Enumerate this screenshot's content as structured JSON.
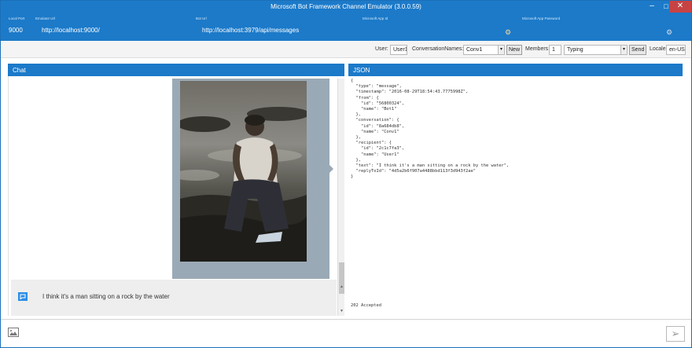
{
  "window": {
    "title": "Microsoft Bot Framework Channel Emulator (3.0.0.59)",
    "minimize": "–",
    "maximize": "□",
    "close": "✕"
  },
  "settings": {
    "local_port": {
      "label": "Local Port",
      "value": "9000"
    },
    "emulator_url": {
      "label": "Emulator Url",
      "value": "http://localhost:9000/"
    },
    "bot_url": {
      "label": "Bot Url",
      "value": "http://localhost:3979/api/messages"
    },
    "app_id": {
      "label": "Microsoft App Id",
      "value": ""
    },
    "app_password": {
      "label": "Microsoft App Password",
      "value": ""
    },
    "gear_icon": "⚙"
  },
  "toolbar": {
    "user_label": "User:",
    "user_value": "User1",
    "conversation_label": "ConversationNames:",
    "conversation_value": "Conv1",
    "new_button": "New",
    "members_label": "Members",
    "members_value": "1",
    "activity_value": "Typing",
    "send_button": "Send",
    "locale_label": "Locale:",
    "locale_value": "en-US",
    "dropdown_icon": "▾"
  },
  "chat": {
    "header": "Chat",
    "message_text": "I think it's a man sitting on a rock by the water",
    "message_icon": "bot-icon"
  },
  "json_panel": {
    "header": "JSON",
    "content": "{\n  \"type\": \"message\",\n  \"timestamp\": \"2016-08-29T18:54:43.7775998Z\",\n  \"from\": {\n    \"id\": \"56800324\",\n    \"name\": \"Bot1\"\n  },\n  \"conversation\": {\n    \"id\": \"8a684db8\",\n    \"name\": \"Conv1\"\n  },\n  \"recipient\": {\n    \"id\": \"2c1c7fa3\",\n    \"name\": \"User1\"\n  },\n  \"text\": \"I think it's a man sitting on a rock by the water\",\n  \"replyToId\": \"4d5a2b6f907a4488bbd113f3d943f2ae\"\n}",
    "status": "202 Accepted"
  },
  "input_bar": {
    "send_icon": "➢"
  },
  "colors": {
    "accent": "#1c7ac9",
    "close": "#c74343"
  }
}
